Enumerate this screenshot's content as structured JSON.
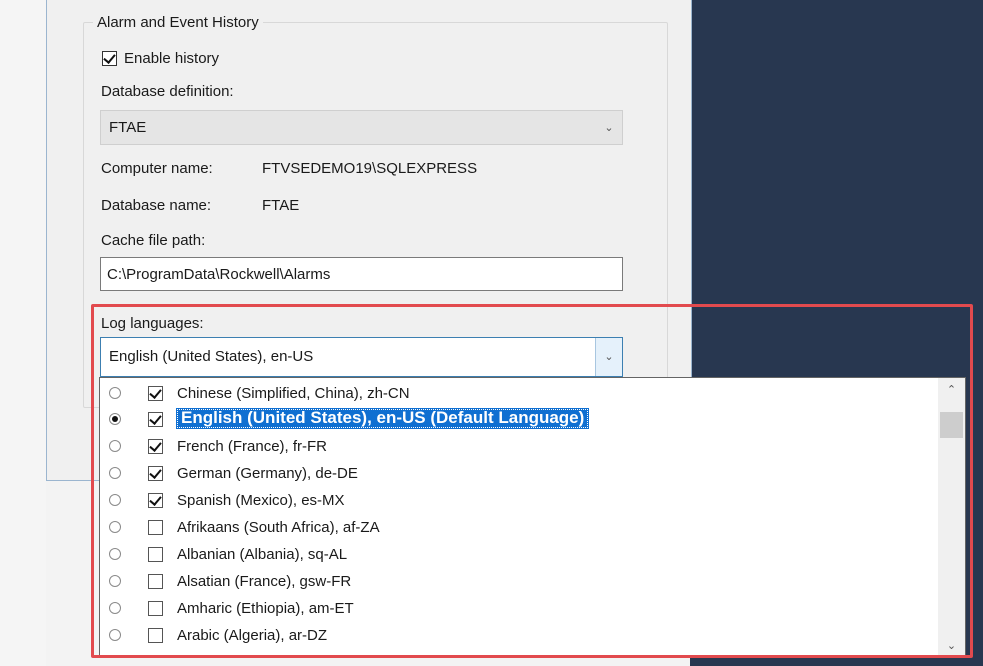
{
  "group": {
    "title": "Alarm and Event History"
  },
  "enable_history": {
    "label": "Enable history",
    "checked": true
  },
  "database_definition": {
    "label": "Database definition:",
    "value": "FTAE"
  },
  "computer_name": {
    "label": "Computer name:",
    "value": "FTVSEDEMO19\\SQLEXPRESS"
  },
  "database_name": {
    "label": "Database name:",
    "value": "FTAE"
  },
  "cache_file_path": {
    "label": "Cache file path:",
    "value": "C:\\ProgramData\\Rockwell\\Alarms"
  },
  "log_languages": {
    "label": "Log languages:",
    "value": "English (United States), en-US",
    "options": [
      {
        "label": "Chinese (Simplified, China), zh-CN",
        "checked": true,
        "default": false
      },
      {
        "label": "English (United States), en-US (Default Language)",
        "checked": true,
        "default": true,
        "selected": true
      },
      {
        "label": "French (France), fr-FR",
        "checked": true,
        "default": false
      },
      {
        "label": "German (Germany), de-DE",
        "checked": true,
        "default": false
      },
      {
        "label": "Spanish (Mexico), es-MX",
        "checked": true,
        "default": false
      },
      {
        "label": "Afrikaans (South Africa), af-ZA",
        "checked": false,
        "default": false
      },
      {
        "label": "Albanian (Albania), sq-AL",
        "checked": false,
        "default": false
      },
      {
        "label": "Alsatian (France), gsw-FR",
        "checked": false,
        "default": false
      },
      {
        "label": "Amharic (Ethiopia), am-ET",
        "checked": false,
        "default": false
      },
      {
        "label": "Arabic (Algeria), ar-DZ",
        "checked": false,
        "default": false
      }
    ]
  },
  "icons": {
    "dropdown_arrow": "chevron-down-icon",
    "scroll_up": "chevron-up-icon",
    "scroll_down": "chevron-down-icon"
  },
  "colors": {
    "highlight": "#0f6fd1",
    "annotation_border": "#e24a4e",
    "background_navy": "#283750"
  }
}
